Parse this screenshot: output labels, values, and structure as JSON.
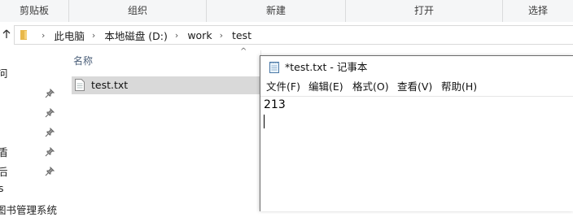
{
  "ribbon": {
    "groups": [
      "剪贴板",
      "组织",
      "新建",
      "打开",
      "选择"
    ]
  },
  "address": {
    "crumbs": [
      "此电脑",
      "本地磁盘 (D:)",
      "work",
      "test"
    ]
  },
  "nav": {
    "items": [
      "问",
      "",
      "",
      "",
      "盾",
      "后",
      "s",
      "图书管理系统"
    ]
  },
  "file_list": {
    "column_name": "名称",
    "files": [
      {
        "name": "test.txt",
        "selected": true
      }
    ]
  },
  "notepad": {
    "title": "*test.txt - 记事本",
    "menu": [
      "文件(F)",
      "编辑(E)",
      "格式(O)",
      "查看(V)",
      "帮助(H)"
    ],
    "content": "213"
  },
  "colors": {
    "selection": "#d9d9d9",
    "folder": "#e8b84a",
    "ribbon_bg": "#f5f6f7"
  }
}
